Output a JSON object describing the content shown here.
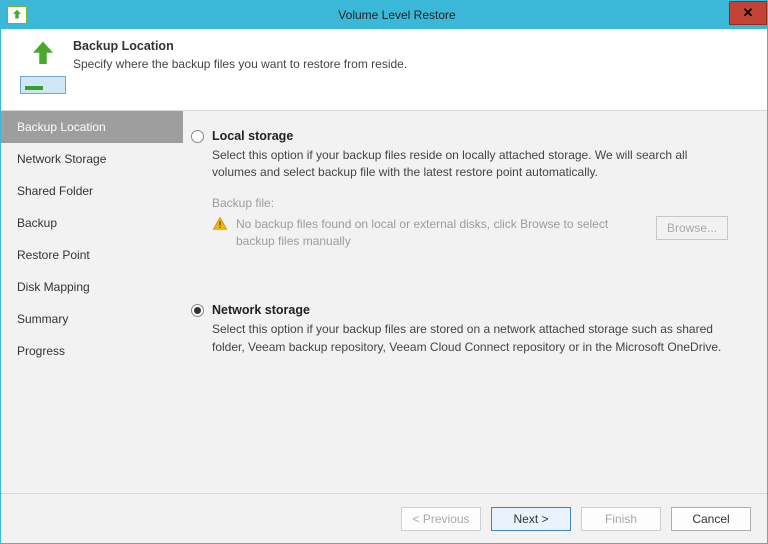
{
  "window": {
    "title": "Volume Level Restore"
  },
  "header": {
    "title": "Backup Location",
    "subtitle": "Specify where the backup files you want to restore from reside."
  },
  "sidebar": {
    "items": [
      {
        "label": "Backup Location",
        "active": true
      },
      {
        "label": "Network Storage"
      },
      {
        "label": "Shared Folder"
      },
      {
        "label": "Backup"
      },
      {
        "label": "Restore Point"
      },
      {
        "label": "Disk Mapping"
      },
      {
        "label": "Summary"
      },
      {
        "label": "Progress"
      }
    ]
  },
  "options": {
    "local": {
      "title": "Local storage",
      "desc": "Select this option if your backup files reside on locally attached storage. We will search all volumes and select backup file with the latest restore point automatically.",
      "backup_file_label": "Backup file:",
      "warn": "No backup files found on local or external disks, click Browse to select backup files manually",
      "browse": "Browse..."
    },
    "network": {
      "title": "Network storage",
      "desc": "Select this option if your backup files are stored on a network attached storage such as shared folder, Veeam backup repository, Veeam Cloud Connect repository or in the Microsoft OneDrive."
    }
  },
  "footer": {
    "previous": "< Previous",
    "next": "Next >",
    "finish": "Finish",
    "cancel": "Cancel"
  }
}
